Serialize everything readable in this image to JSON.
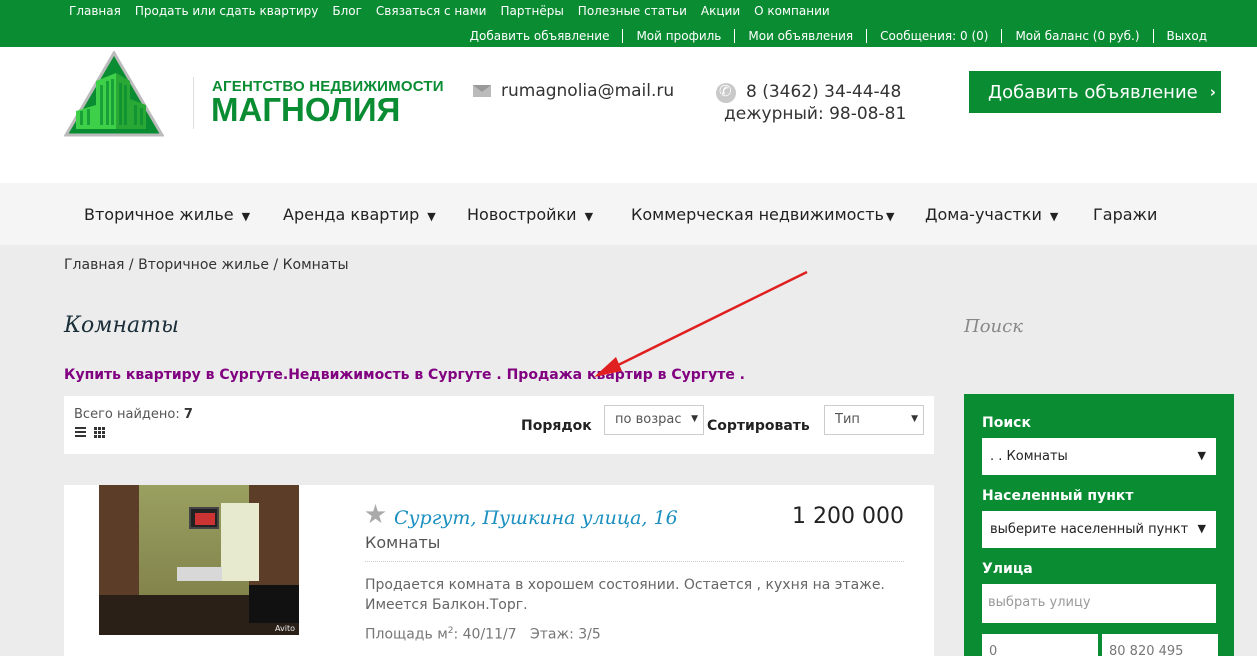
{
  "topnav": [
    "Главная",
    "Продать или сдать квартиру",
    "Блог",
    "Связаться с нами",
    "Партнёры",
    "Полезные статьи",
    "Акции",
    "О компании"
  ],
  "usernav": [
    "Добавить объявление",
    "Мой профиль",
    "Мои объявления",
    "Сообщения: 0 (0)",
    "Мой баланс (0 руб.)",
    "Выход"
  ],
  "header": {
    "logo_sub": "АГЕНТСТВО НЕДВИЖИМОСТИ",
    "logo_main": "МАГНОЛИЯ",
    "email": "rumagnolia@mail.ru",
    "phone": "8 (3462) 34-44-48",
    "duty": "дежурный: 98-08-81",
    "add_button": "Добавить объявление"
  },
  "mainnav": [
    "Вторичное жилье",
    "Аренда квартир",
    "Новостройки",
    "Коммерческая недвижимость",
    "Дома-участки",
    "Гаражи"
  ],
  "breadcrumb": "Главная / Вторичное жилье / Комнаты",
  "page_title": "Комнаты",
  "side_title": "Поиск",
  "promo_text": "Купить квартиру в Сургуте.Недвижимость в Сургуте . Продажа квартир в Сургуте .",
  "toolbar": {
    "found_label": "Всего найдено:",
    "found_count": "7",
    "order_label": "Порядок",
    "order_value": "по возрас",
    "sort_label": "Сортировать",
    "sort_value": "Тип"
  },
  "listing": {
    "address": "Сургут, Пушкина улица, 16",
    "price": "1 200 000",
    "type": "Комнаты",
    "description": "Продается комната в хорошем состоянии. Остается , кухня на этаже. Имеется Балкон.Торг.",
    "area_label": "Площадь м",
    "area_sup": "2",
    "area_value": ": 40/11/7",
    "floor": "Этаж: 3/5",
    "watermark": "Avito"
  },
  "search": {
    "label_search": "Поиск",
    "category_value": ". . Комнаты",
    "label_locality": "Населенный пункт",
    "locality_value": "выберите населенный пункт",
    "label_street": "Улица",
    "street_placeholder": "выбрать улицу",
    "price_from": "0",
    "price_to": "80 820 495"
  },
  "colors": {
    "brand_green": "#0a8c33",
    "promo_purple": "#800080",
    "link_blue": "#1a8fc0",
    "arrow_red": "#e02020"
  }
}
